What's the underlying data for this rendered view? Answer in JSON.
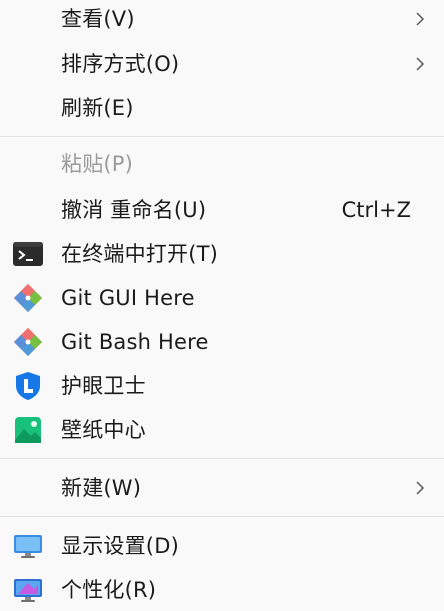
{
  "menu": {
    "view": {
      "label": "查看(V)"
    },
    "sort": {
      "label": "排序方式(O)"
    },
    "refresh": {
      "label": "刷新(E)"
    },
    "paste": {
      "label": "粘贴(P)"
    },
    "undo_rename": {
      "label": "撤消 重命名(U)",
      "shortcut": "Ctrl+Z"
    },
    "open_terminal": {
      "label": "在终端中打开(T)",
      "icon": "terminal-icon"
    },
    "git_gui": {
      "label": "Git GUI Here",
      "icon": "git-icon"
    },
    "git_bash": {
      "label": "Git Bash Here",
      "icon": "git-icon"
    },
    "eye_guard": {
      "label": "护眼卫士",
      "icon": "eye-guard-icon"
    },
    "wallpaper": {
      "label": "壁纸中心",
      "icon": "wallpaper-icon"
    },
    "new": {
      "label": "新建(W)"
    },
    "display": {
      "label": "显示设置(D)",
      "icon": "monitor-icon"
    },
    "personalize": {
      "label": "个性化(R)",
      "icon": "personalize-icon"
    }
  },
  "colors": {
    "background": "#f9f9f9",
    "text": "#1b1b1b",
    "disabled_text": "#9b9b9b",
    "separator": "#e3e3e3"
  }
}
